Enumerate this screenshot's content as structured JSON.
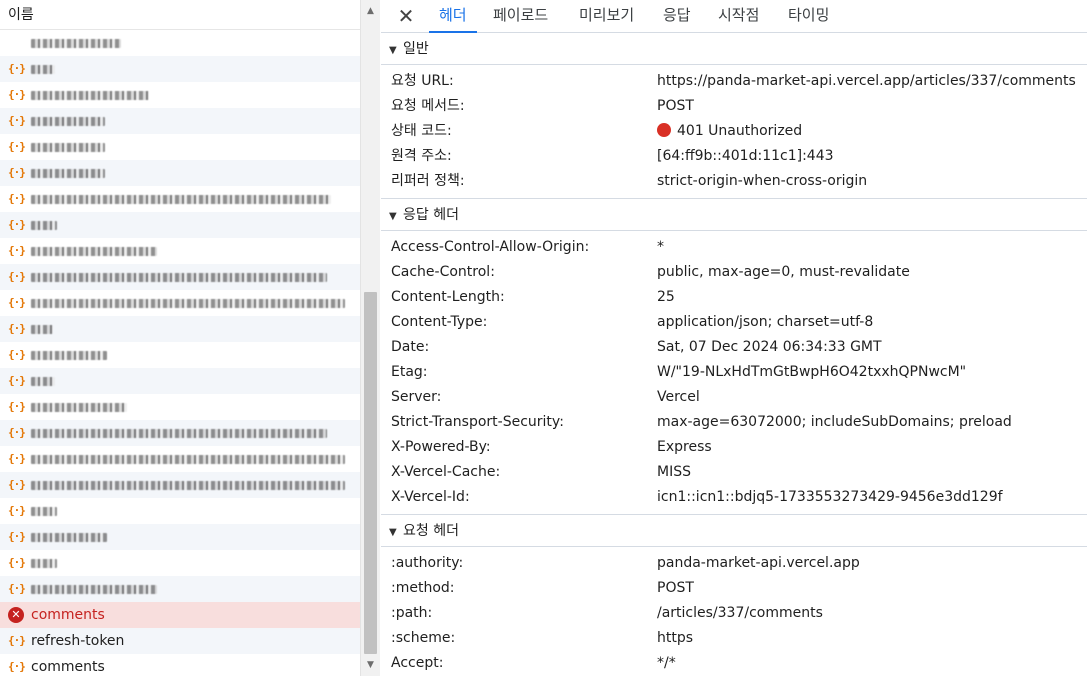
{
  "network_list": {
    "column_header": "이름",
    "rows": [
      {
        "name": "",
        "obscured": true,
        "blur_w": 90,
        "icon": "none"
      },
      {
        "name": "",
        "obscured": true,
        "blur_w": 24,
        "icon": "xhr"
      },
      {
        "name": "",
        "obscured": true,
        "blur_w": 118,
        "icon": "xhr"
      },
      {
        "name": "",
        "obscured": true,
        "blur_w": 74,
        "icon": "xhr"
      },
      {
        "name": "",
        "obscured": true,
        "blur_w": 74,
        "icon": "xhr"
      },
      {
        "name": "",
        "obscured": true,
        "blur_w": 74,
        "icon": "xhr"
      },
      {
        "name": "",
        "obscured": true,
        "blur_w": 300,
        "icon": "xhr"
      },
      {
        "name": "",
        "obscured": true,
        "blur_w": 26,
        "icon": "xhr"
      },
      {
        "name": "",
        "obscured": true,
        "blur_w": 126,
        "icon": "xhr"
      },
      {
        "name": "",
        "obscured": true,
        "blur_w": 296,
        "icon": "xhr"
      },
      {
        "name": "",
        "obscured": true,
        "blur_w": 314,
        "icon": "xhr"
      },
      {
        "name": "",
        "obscured": true,
        "blur_w": 22,
        "icon": "xhr"
      },
      {
        "name": "",
        "obscured": true,
        "blur_w": 76,
        "icon": "xhr"
      },
      {
        "name": "",
        "obscured": true,
        "blur_w": 24,
        "icon": "xhr"
      },
      {
        "name": "",
        "obscured": true,
        "blur_w": 96,
        "icon": "xhr"
      },
      {
        "name": "",
        "obscured": true,
        "blur_w": 296,
        "icon": "xhr"
      },
      {
        "name": "",
        "obscured": true,
        "blur_w": 314,
        "icon": "xhr"
      },
      {
        "name": "",
        "obscured": true,
        "blur_w": 314,
        "icon": "xhr"
      },
      {
        "name": "",
        "obscured": true,
        "blur_w": 26,
        "icon": "xhr"
      },
      {
        "name": "",
        "obscured": true,
        "blur_w": 76,
        "icon": "xhr"
      },
      {
        "name": "",
        "obscured": true,
        "blur_w": 26,
        "icon": "xhr"
      },
      {
        "name": "",
        "obscured": true,
        "blur_w": 126,
        "icon": "xhr"
      },
      {
        "name": "comments",
        "obscured": false,
        "icon": "error",
        "status": "error"
      },
      {
        "name": "refresh-token",
        "obscured": false,
        "icon": "xhr"
      },
      {
        "name": "comments",
        "obscured": false,
        "icon": "xhr"
      }
    ]
  },
  "details": {
    "close_icon": "close-icon",
    "tabs": [
      {
        "label": "헤더",
        "active": true
      },
      {
        "label": "페이로드",
        "active": false
      },
      {
        "label": "미리보기",
        "active": false
      },
      {
        "label": "응답",
        "active": false
      },
      {
        "label": "시작점",
        "active": false
      },
      {
        "label": "타이밍",
        "active": false
      }
    ],
    "sections": [
      {
        "title": "일반",
        "items": [
          {
            "key": "요청 URL:",
            "value": "https://panda-market-api.vercel.app/articles/337/comments"
          },
          {
            "key": "요청 메서드:",
            "value": "POST"
          },
          {
            "key": "상태 코드:",
            "value": "401 Unauthorized",
            "status_dot": true
          },
          {
            "key": "원격 주소:",
            "value": "[64:ff9b::401d:11c1]:443"
          },
          {
            "key": "리퍼러 정책:",
            "value": "strict-origin-when-cross-origin"
          }
        ]
      },
      {
        "title": "응답 헤더",
        "items": [
          {
            "key": "Access-Control-Allow-Origin:",
            "value": "*"
          },
          {
            "key": "Cache-Control:",
            "value": "public, max-age=0, must-revalidate"
          },
          {
            "key": "Content-Length:",
            "value": "25"
          },
          {
            "key": "Content-Type:",
            "value": "application/json; charset=utf-8"
          },
          {
            "key": "Date:",
            "value": "Sat, 07 Dec 2024 06:34:33 GMT"
          },
          {
            "key": "Etag:",
            "value": "W/\"19-NLxHdTmGtBwpH6O42txxhQPNwcM\""
          },
          {
            "key": "Server:",
            "value": "Vercel"
          },
          {
            "key": "Strict-Transport-Security:",
            "value": "max-age=63072000; includeSubDomains; preload"
          },
          {
            "key": "X-Powered-By:",
            "value": "Express"
          },
          {
            "key": "X-Vercel-Cache:",
            "value": "MISS"
          },
          {
            "key": "X-Vercel-Id:",
            "value": "icn1::icn1::bdjq5-1733553273429-9456e3dd129f"
          }
        ]
      },
      {
        "title": "요청 헤더",
        "items": [
          {
            "key": ":authority:",
            "value": "panda-market-api.vercel.app"
          },
          {
            "key": ":method:",
            "value": "POST"
          },
          {
            "key": ":path:",
            "value": "/articles/337/comments"
          },
          {
            "key": ":scheme:",
            "value": "https"
          },
          {
            "key": "Accept:",
            "value": "*/*"
          }
        ]
      }
    ]
  },
  "colors": {
    "accent": "#1a73e8",
    "error": "#d93025",
    "error_row_bg": "#f8dedd",
    "xhr_icon": "#e37400"
  }
}
